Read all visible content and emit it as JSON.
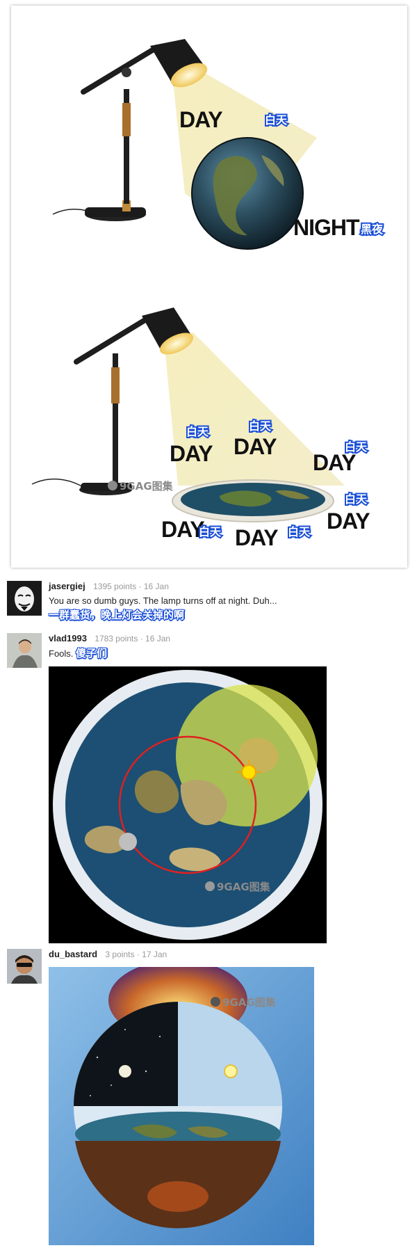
{
  "meme": {
    "label_day": "DAY",
    "label_night": "NIGHT",
    "cn_day": "白天",
    "cn_night": "黑夜",
    "watermark": "9GAG图集"
  },
  "comments": [
    {
      "username": "jasergiej",
      "points": "1395 points",
      "date": "16 Jan",
      "text": "You are so dumb guys. The lamp turns off at night. Duh...",
      "translation": "一群蠢货，晚上灯会关掉的啊",
      "avatar_icon": "guy-fawkes-mask-avatar"
    },
    {
      "username": "vlad1993",
      "points": "1783 points",
      "date": "16 Jan",
      "text": "Fools.",
      "translation": "傻子们",
      "avatar_icon": "person-photo-avatar",
      "watermark": "9GAG图集"
    },
    {
      "username": "du_bastard",
      "points": "3 points",
      "date": "17 Jan",
      "avatar_icon": "person-sunglasses-avatar",
      "watermark": "9GAG图集"
    }
  ],
  "separator": "·",
  "colors": {
    "cn_outline": "#1a4fd6",
    "ocean": "#1c4f73",
    "sun_zone": "#d8e34a",
    "orbit": "#e02020"
  }
}
